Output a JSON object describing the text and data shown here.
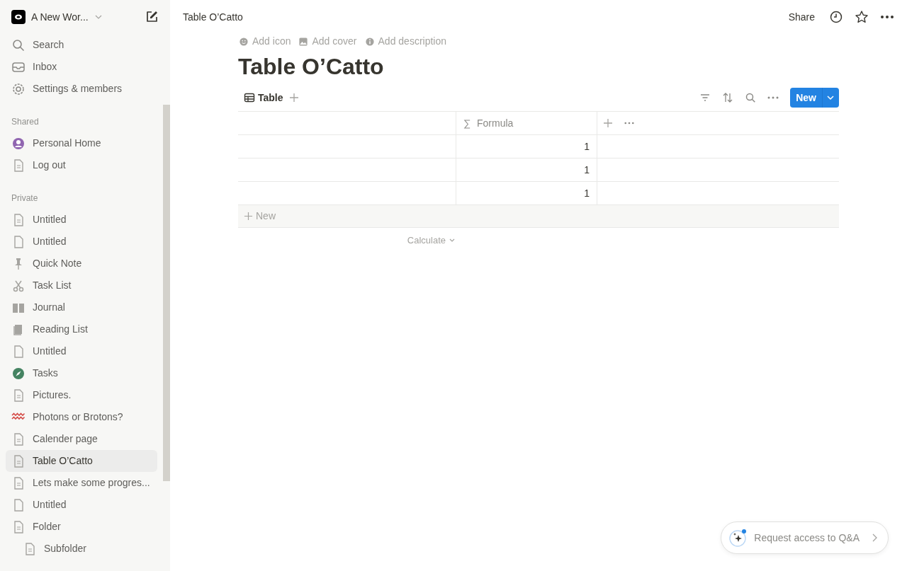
{
  "workspace": {
    "name": "A New Wor..."
  },
  "sidebar": {
    "top_items": [
      {
        "label": "Search",
        "kind": "search"
      },
      {
        "label": "Inbox",
        "kind": "inbox"
      },
      {
        "label": "Settings & members",
        "kind": "gear"
      }
    ],
    "sections": [
      {
        "title": "Shared",
        "items": [
          {
            "label": "Personal Home",
            "kind": "user",
            "selected": false
          },
          {
            "label": "Log out",
            "kind": "page",
            "selected": false
          }
        ]
      },
      {
        "title": "Private",
        "items": [
          {
            "label": "Untitled",
            "kind": "page",
            "selected": false
          },
          {
            "label": "Untitled",
            "kind": "blank",
            "selected": false
          },
          {
            "label": "Quick Note",
            "kind": "pin",
            "selected": false
          },
          {
            "label": "Task List",
            "kind": "scissors",
            "selected": false
          },
          {
            "label": "Journal",
            "kind": "openbook",
            "selected": false
          },
          {
            "label": "Reading List",
            "kind": "book",
            "selected": false
          },
          {
            "label": "Untitled",
            "kind": "blank",
            "selected": false
          },
          {
            "label": "Tasks",
            "kind": "compass",
            "selected": false
          },
          {
            "label": "Pictures.",
            "kind": "page",
            "selected": false
          },
          {
            "label": "Photons or Brotons?",
            "kind": "waves",
            "selected": false
          },
          {
            "label": "Calender page",
            "kind": "page",
            "selected": false
          },
          {
            "label": "Table O’Catto",
            "kind": "page",
            "selected": true
          },
          {
            "label": "Lets make some progres...",
            "kind": "page",
            "selected": false
          },
          {
            "label": "Untitled",
            "kind": "blank",
            "selected": false
          },
          {
            "label": "Folder",
            "kind": "page",
            "selected": false,
            "children": [
              {
                "label": "Subfolder",
                "kind": "page",
                "selected": false
              }
            ]
          }
        ]
      }
    ]
  },
  "breadcrumb": "Table O’Catto",
  "topbar": {
    "share": "Share"
  },
  "page_actions": [
    {
      "label": "Add icon",
      "kind": "smile"
    },
    {
      "label": "Add cover",
      "kind": "image"
    },
    {
      "label": "Add description",
      "kind": "info"
    }
  ],
  "title": "Table O’Catto",
  "view_tab": {
    "label": "Table"
  },
  "new_button": "New",
  "table": {
    "columns": [
      {
        "label": "Formula",
        "kind": "formula"
      }
    ],
    "rows": [
      {
        "formula": "1"
      },
      {
        "formula": "1"
      },
      {
        "formula": "1"
      }
    ],
    "new_row": "New",
    "calculate": "Calculate"
  },
  "qa_button": "Request access to Q&A"
}
